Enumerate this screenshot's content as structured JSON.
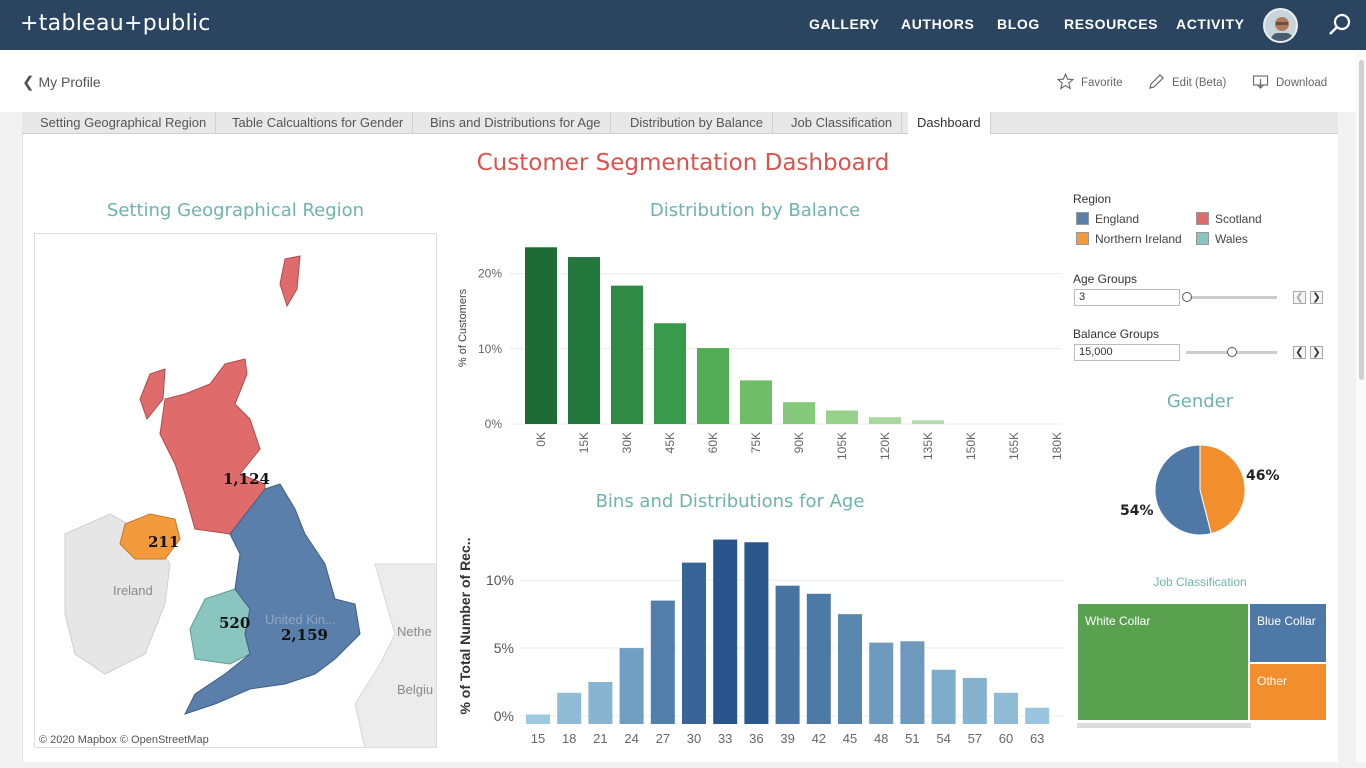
{
  "nav": {
    "logo": "+tableau+public",
    "items": [
      "GALLERY",
      "AUTHORS",
      "BLOG",
      "RESOURCES",
      "ACTIVITY"
    ]
  },
  "profile": {
    "back_label": "My Profile"
  },
  "actions": {
    "favorite": "Favorite",
    "edit": "Edit (Beta)",
    "download": "Download"
  },
  "tabs": [
    "Setting Geographical Region",
    "Table Calcualtions for Gender",
    "Bins and Distributions for Age",
    "Distribution by Balance",
    "Job Classification",
    "Dashboard"
  ],
  "active_tab": "Dashboard",
  "dashboard": {
    "title": "Customer Segmentation Dashboard",
    "map": {
      "title": "Setting Geographical Region",
      "labels": {
        "scotland": "1,124",
        "northern_ireland": "211",
        "wales": "520",
        "england": "2,159"
      },
      "place_names": {
        "ireland": "Ireland",
        "uk": "United Kin...",
        "netherlands": "Nethe",
        "belgium": "Belgiu"
      },
      "attribution": "© 2020 Mapbox © OpenStreetMap"
    },
    "legend": {
      "title": "Region",
      "items": [
        {
          "label": "England",
          "color": "#5b7fab"
        },
        {
          "label": "Scotland",
          "color": "#e06b6b"
        },
        {
          "label": "Northern Ireland",
          "color": "#f29a3c"
        },
        {
          "label": "Wales",
          "color": "#8ac5bf"
        }
      ]
    },
    "params": {
      "age": {
        "label": "Age Groups",
        "value": "3",
        "slider_fraction": 0.0
      },
      "balance": {
        "label": "Balance Groups",
        "value": "15,000",
        "slider_fraction": 0.5
      }
    },
    "gender": {
      "title": "Gender",
      "labels": [
        "54%",
        "46%"
      ]
    },
    "job": {
      "title": "Job Classification",
      "cells": [
        "White Collar",
        "Blue Collar",
        "Other"
      ]
    }
  },
  "chart_data": [
    {
      "type": "bar",
      "title": "Distribution by Balance",
      "ylabel": "% of Customers",
      "categories": [
        "0K",
        "15K",
        "30K",
        "45K",
        "60K",
        "75K",
        "90K",
        "105K",
        "120K",
        "135K",
        "150K",
        "165K",
        "180K"
      ],
      "values": [
        23.5,
        22.2,
        18.4,
        13.4,
        10.1,
        5.8,
        2.9,
        1.8,
        0.9,
        0.5,
        0,
        0,
        0
      ],
      "yticks": [
        "0%",
        "10%",
        "20%"
      ],
      "ylim": [
        0,
        25
      ]
    },
    {
      "type": "bar",
      "title": "Bins and Distributions for Age",
      "ylabel": "% of Total Number of Rec..",
      "categories": [
        "15",
        "18",
        "21",
        "24",
        "27",
        "30",
        "33",
        "36",
        "39",
        "42",
        "45",
        "48",
        "51",
        "54",
        "57",
        "60",
        "63"
      ],
      "values": [
        0.1,
        1.7,
        2.5,
        5.0,
        8.5,
        11.3,
        13.0,
        12.8,
        9.6,
        9.0,
        7.5,
        5.4,
        5.5,
        3.4,
        2.8,
        1.7,
        0.6
      ],
      "yticks": [
        "0%",
        "5%",
        "10%"
      ],
      "ylim": [
        -0.6,
        14
      ]
    },
    {
      "type": "pie",
      "title": "Gender",
      "slices": [
        {
          "label": "54%",
          "value": 54,
          "color": "#4e79a7"
        },
        {
          "label": "46%",
          "value": 46,
          "color": "#f28e2b"
        }
      ]
    }
  ]
}
